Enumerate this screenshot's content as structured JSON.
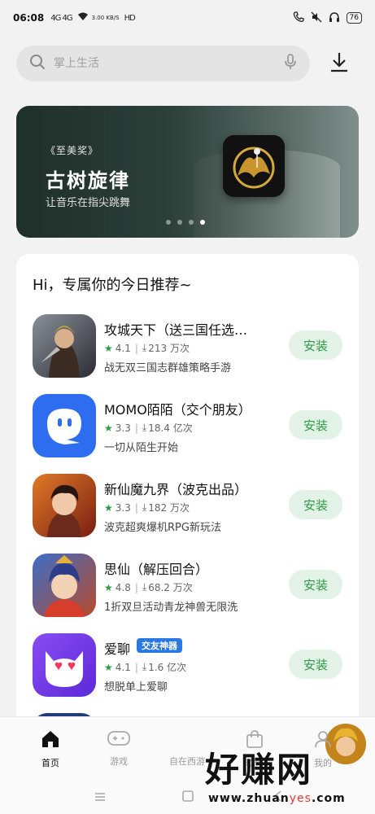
{
  "status_bar": {
    "time": "06:08",
    "signal_text": "4G 4G",
    "net_speed": "3.00 KB/S",
    "hd_label": "HD",
    "battery": "76"
  },
  "search": {
    "placeholder": "掌上生活"
  },
  "banner": {
    "award": "《至美奖》",
    "title": "古树旋律",
    "subtitle": "让音乐在指尖跳舞"
  },
  "recommend": {
    "title": "Hi，专属你的今日推荐~",
    "apps": [
      {
        "name": "攻城天下（送三国任选…",
        "rating": "4.1",
        "downloads": "213 万次",
        "desc": "战无双三国志群雄策略手游",
        "install": "安装",
        "tag": ""
      },
      {
        "name": "MOMO陌陌（交个朋友）",
        "rating": "3.3",
        "downloads": "18.4 亿次",
        "desc": "一切从陌生开始",
        "install": "安装",
        "tag": ""
      },
      {
        "name": "新仙魔九界（波克出品）",
        "rating": "3.3",
        "downloads": "182 万次",
        "desc": "波克超爽爆机RPG新玩法",
        "install": "安装",
        "tag": ""
      },
      {
        "name": "思仙（解压回合）",
        "rating": "4.8",
        "downloads": "68.2 万次",
        "desc": "1折双旦活动青龙神兽无限洗",
        "install": "安装",
        "tag": ""
      },
      {
        "name": "爱聊",
        "rating": "4.1",
        "downloads": "1.6 亿次",
        "desc": "想脱单上爱聊",
        "install": "安装",
        "tag": "交友神器"
      }
    ]
  },
  "bottom_nav": {
    "home": "首页",
    "games": "游戏",
    "center": "自在西游",
    "store": "软件",
    "me": "我的"
  },
  "watermark": {
    "text": "好赚网",
    "url_prefix": "www.zhuan",
    "url_accent": "yes",
    "url_suffix": ".com"
  },
  "colors": {
    "accent_green": "#2e9a48",
    "install_bg": "#e2f2e6",
    "tag_blue": "#2a78e4"
  }
}
